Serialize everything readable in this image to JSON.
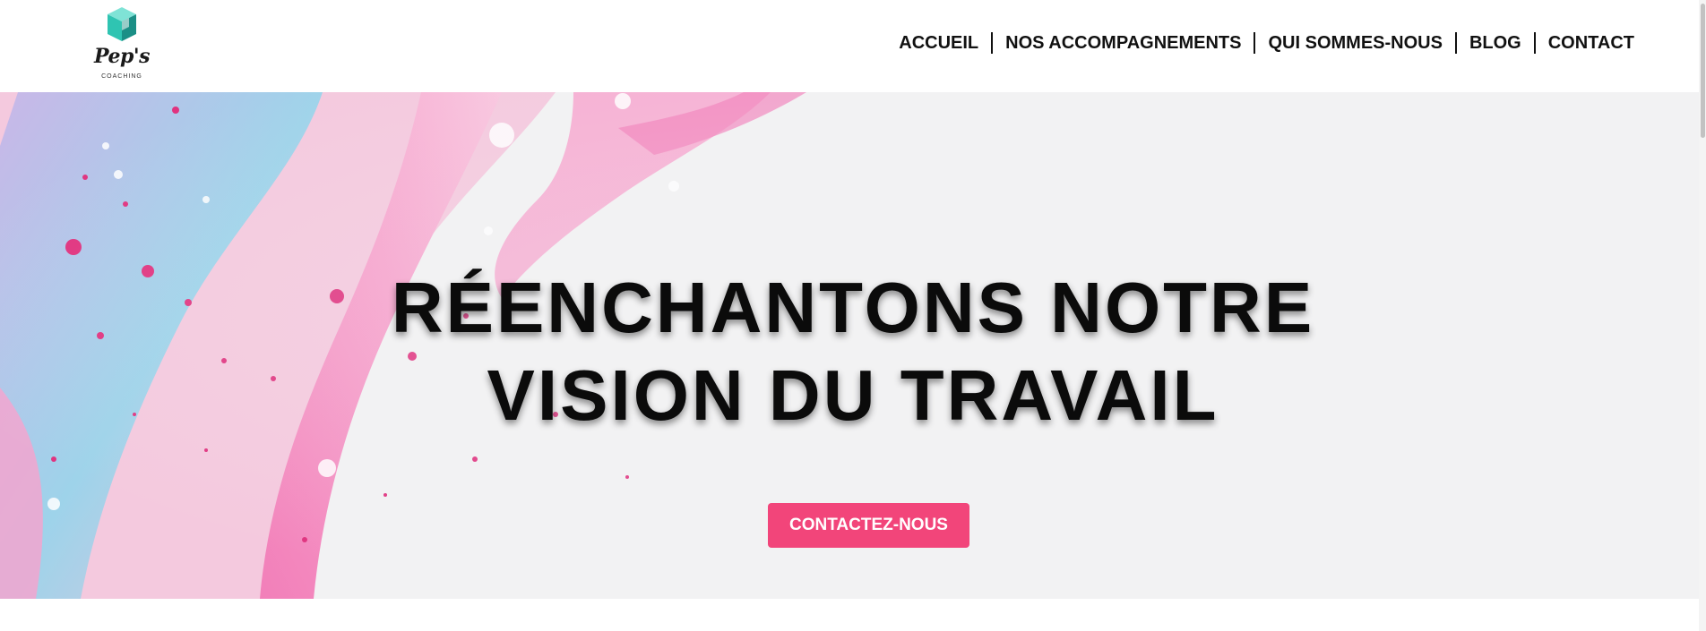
{
  "brand": {
    "name": "Pep's",
    "tagline": "COACHING",
    "icon": "cube-logo-icon",
    "colors": {
      "teal": "#2fc4b2",
      "teal_light": "#7fe3d6",
      "teal_dark": "#1b8f86"
    }
  },
  "nav": {
    "items": [
      {
        "label": "ACCUEIL"
      },
      {
        "label": "NOS ACCOMPAGNEMENTS"
      },
      {
        "label": "QUI SOMMES-NOUS"
      },
      {
        "label": "BLOG"
      },
      {
        "label": "CONTACT"
      }
    ]
  },
  "hero": {
    "title_line1": "RÉENCHANTONS NOTRE",
    "title_line2": "VISION DU TRAVAIL",
    "cta_label": "CONTACTEZ-NOUS",
    "background": "pink-blue-fluid-art",
    "accent_color": "#f2457a"
  }
}
